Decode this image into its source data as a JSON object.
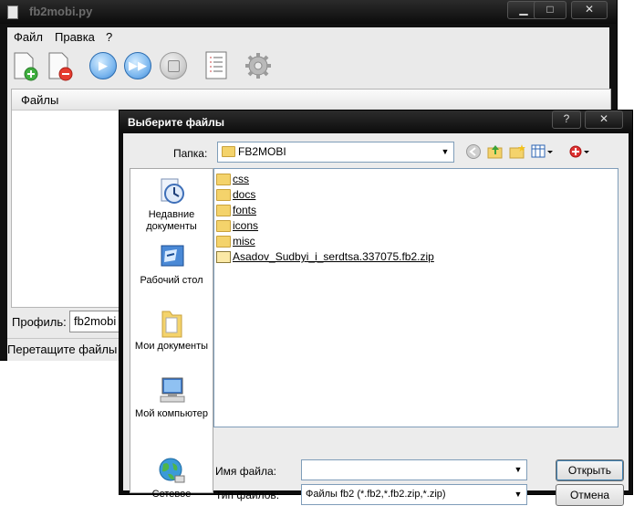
{
  "main_window": {
    "title": "fb2mobi.py",
    "menu": [
      "Файл",
      "Правка",
      "?"
    ],
    "toolbar_icons": [
      "add-file-icon",
      "remove-file-icon",
      "play-icon",
      "fast-forward-icon",
      "stop-icon",
      "document-log-icon",
      "gear-icon"
    ],
    "files_header": "Файлы",
    "profile_label": "Профиль:",
    "profile_value": "fb2mobi",
    "status": "Перетащите файлы"
  },
  "dialog": {
    "title": "Выберите файлы",
    "help_button": "?",
    "folder_label": "Папка:",
    "folder_value": "FB2MOBI",
    "places": [
      {
        "label": "Недавние документы",
        "icon": "recent-documents-icon"
      },
      {
        "label": "Рабочий стол",
        "icon": "desktop-icon"
      },
      {
        "label": "Мои документы",
        "icon": "my-documents-icon"
      },
      {
        "label": "Мой компьютер",
        "icon": "my-computer-icon"
      },
      {
        "label": "Сетевое",
        "icon": "network-icon"
      }
    ],
    "files": [
      {
        "name": "css",
        "type": "folder"
      },
      {
        "name": "docs",
        "type": "folder"
      },
      {
        "name": "fonts",
        "type": "folder"
      },
      {
        "name": "icons",
        "type": "folder"
      },
      {
        "name": "misc",
        "type": "folder"
      },
      {
        "name": "Asadov_Sudbyi_i_serdtsa.337075.fb2.zip",
        "type": "zip"
      }
    ],
    "filename_label": "Имя файла:",
    "filename_value": "",
    "filetype_label": "Тип файлов:",
    "filetype_value": "Файлы fb2 (*.fb2,*.fb2.zip,*.zip)",
    "open_button": "Открыть",
    "cancel_button": "Отмена"
  }
}
